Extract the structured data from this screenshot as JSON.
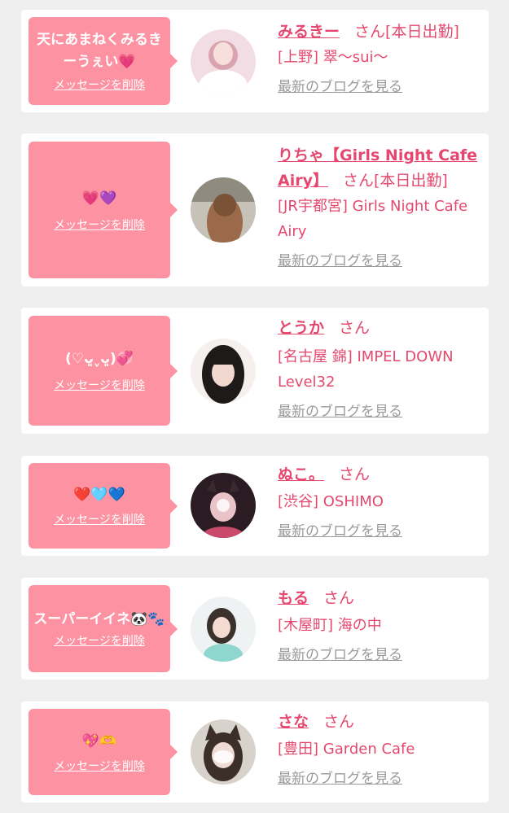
{
  "items": [
    {
      "message": "天にあまねくみるきーうぇい💗",
      "delete_label": "メッセージを削除",
      "name": "みるきー",
      "san": "さん",
      "status": "[本日出勤]",
      "shop": "[上野] 翠〜sui〜",
      "blog_label": "最新のブログを見る"
    },
    {
      "message": "💗💜",
      "delete_label": "メッセージを削除",
      "name": "りちゃ【Girls Night Cafe Airy】",
      "san": "さん",
      "status": "[本日出勤]",
      "shop": "[JR宇都宮] Girls Night Cafe Airy",
      "blog_label": "最新のブログを見る"
    },
    {
      "message": "(♡ᴗ͈ˬᴗ͈)💞",
      "delete_label": "メッセージを削除",
      "name": "とうか",
      "san": "さん",
      "status": "",
      "shop": "[名古屋 錦] IMPEL DOWN Level32",
      "blog_label": "最新のブログを見る"
    },
    {
      "message": "❤️🩵💙",
      "delete_label": "メッセージを削除",
      "name": "ぬこ。",
      "san": "さん",
      "status": "",
      "shop": "[渋谷] OSHIMO",
      "blog_label": "最新のブログを見る"
    },
    {
      "message": "スーパーイイネ🐼🐾",
      "delete_label": "メッセージを削除",
      "name": "もる",
      "san": "さん",
      "status": "",
      "shop": "[木屋町] 海の中",
      "blog_label": "最新のブログを見る"
    },
    {
      "message": "💖🫶",
      "delete_label": "メッセージを削除",
      "name": "さな",
      "san": "さん",
      "status": "",
      "shop": "[豊田] Garden Cafe",
      "blog_label": "最新のブログを見る"
    }
  ],
  "colors": {
    "page_bg": "#efefef",
    "card_bg": "#ffffff",
    "bubble_bg": "#fd93a2",
    "accent_text": "#e5486e",
    "link_gray": "#9a9a9a"
  }
}
